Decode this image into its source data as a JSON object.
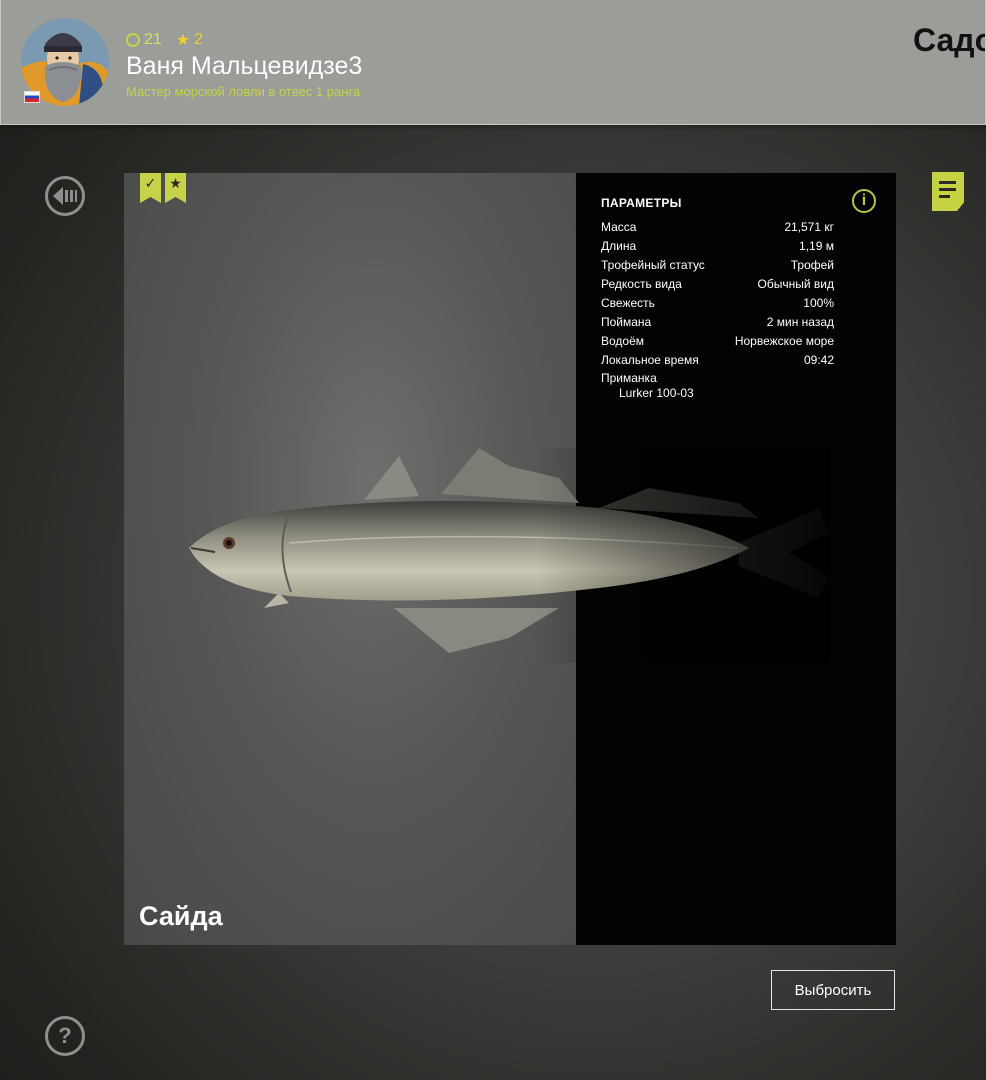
{
  "header": {
    "player_name": "Ваня Мальцевидзе3",
    "player_rank": "Мастер морской ловли в отвес 1 ранга",
    "level": "21",
    "stars": "2",
    "country_flag": "russia-flag",
    "title": "Садок"
  },
  "icons": {
    "back": "back-arrow-icon",
    "help": "help-question-icon",
    "notes": "notes-list-icon",
    "info": "info-icon",
    "badge_check": "checkmark-badge-icon",
    "badge_star": "star-badge-icon"
  },
  "colors": {
    "accent": "#c5d24a",
    "star": "#ecd22a"
  },
  "fish": {
    "name": "Сайда"
  },
  "params": {
    "title": "ПАРАМЕТРЫ",
    "rows": [
      {
        "label": "Масса",
        "value": "21,571 кг"
      },
      {
        "label": "Длина",
        "value": "1,19 м"
      },
      {
        "label": "Трофейный статус",
        "value": "Трофей"
      },
      {
        "label": "Редкость вида",
        "value": "Обычный вид"
      },
      {
        "label": "Свежесть",
        "value": "100%"
      },
      {
        "label": "Поймана",
        "value": "2 мин назад"
      },
      {
        "label": "Водоём",
        "value": "Норвежское море"
      },
      {
        "label": "Локальное время",
        "value": "09:42"
      }
    ],
    "lure_label": "Приманка",
    "lure_value": "Lurker 100-03"
  },
  "actions": {
    "discard_label": "Выбросить"
  }
}
